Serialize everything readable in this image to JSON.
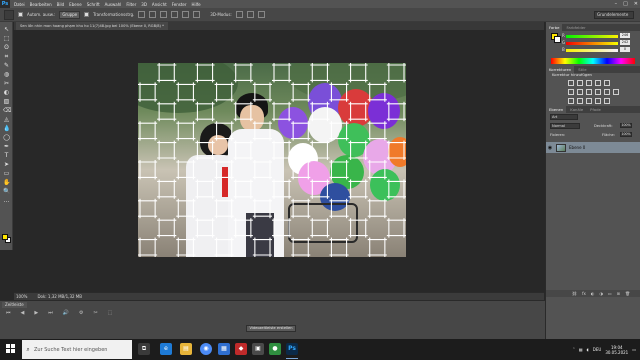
{
  "app": {
    "logo": "Ps",
    "menu": [
      "Datei",
      "Bearbeiten",
      "Bild",
      "Ebene",
      "Schrift",
      "Auswahl",
      "Filter",
      "3D",
      "Ansicht",
      "Fenster",
      "Hilfe"
    ],
    "window_controls": [
      "–",
      "□",
      "✕"
    ]
  },
  "options": {
    "auto_select_label": "Autom. ausw.:",
    "auto_select_value": "Gruppe",
    "transform_label": "Transformationsstrg.",
    "mode_3d": "3D-Modus:",
    "workspace": "Grundelemente"
  },
  "document": {
    "tab_label": "Sen lồn nhin mon hoang phạm khu ho 11(7)48.jpg bei 100% (Ebene 0, RGB/8) *"
  },
  "tools": [
    "↖",
    "⬚",
    "ʘ",
    "⌗",
    "✎",
    "◍",
    "✂",
    "◐",
    "▧",
    "⌫",
    "◬",
    "💧",
    "◯",
    "✒",
    "T",
    "➤",
    "▭",
    "✋",
    "🔍",
    "…"
  ],
  "colors": {
    "foreground": "#ffe600",
    "background": "#ffffff",
    "accent": "#31a8ff"
  },
  "status": {
    "zoom": "100%",
    "doc_size": "Dok: 1,32 MB/1,32 MB"
  },
  "timeline": {
    "tab": "Zeitleiste",
    "controls": [
      "⏮",
      "◀",
      "▶",
      "⏭",
      "🔊",
      "⚙",
      "✂",
      "⬚"
    ],
    "create_button": "Videozeitleiste erstellen"
  },
  "panels": {
    "color_tabs": [
      "Farbe",
      "Farbfelder"
    ],
    "sliders": [
      {
        "label": "R",
        "value": "246"
      },
      {
        "label": "G",
        "value": "242"
      },
      {
        "label": "B",
        "value": "0"
      }
    ],
    "adjust_tabs": [
      "Korrekturen",
      "Stile"
    ],
    "adjust_title": "Korrektur hinzufügen",
    "layers_tabs": [
      "Ebenen",
      "Kanäle",
      "Pfade"
    ],
    "layer_kind": "Art",
    "blend_mode": "Normal",
    "opacity_label": "Deckkraft:",
    "opacity_value": "100%",
    "lock_label": "Fixieren:",
    "fill_label": "Fläche:",
    "fill_value": "100%",
    "layer_name": "Ebene 0",
    "footer_icons": [
      "⛓",
      "fx",
      "◐",
      "◑",
      "▭",
      "⊞",
      "🗑"
    ]
  },
  "taskbar": {
    "search_placeholder": "Zur Suche Text hier eingeben",
    "apps": [
      {
        "name": "task-view",
        "glyph": "⧉",
        "color": "#3a3a3a"
      },
      {
        "name": "edge",
        "glyph": "e",
        "color": "#1e7bd7"
      },
      {
        "name": "explorer",
        "glyph": "▤",
        "color": "#e8b53a"
      },
      {
        "name": "chrome",
        "glyph": "◉",
        "color": "#4c8bf5"
      },
      {
        "name": "store",
        "glyph": "▦",
        "color": "#2f6fd1"
      },
      {
        "name": "app-red",
        "glyph": "◆",
        "color": "#c02a2a"
      },
      {
        "name": "app-dark",
        "glyph": "▣",
        "color": "#4a4a4a"
      },
      {
        "name": "app-green",
        "glyph": "●",
        "color": "#2f8f3f"
      },
      {
        "name": "photoshop",
        "glyph": "Ps",
        "color": "#0b2a48"
      }
    ],
    "tray_lang": "DEU",
    "time": "19:04",
    "date": "30.05.2021"
  }
}
